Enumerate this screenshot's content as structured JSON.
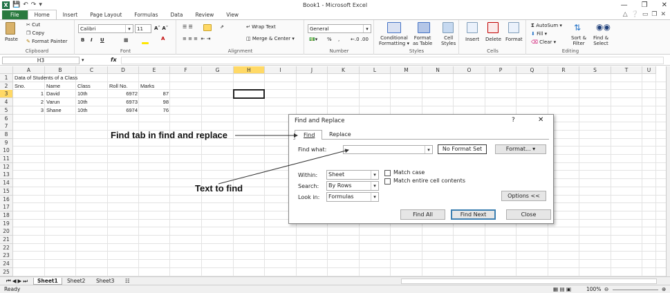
{
  "window": {
    "title": "Book1 - Microsoft Excel"
  },
  "ribbon_tabs": [
    "File",
    "Home",
    "Insert",
    "Page Layout",
    "Formulas",
    "Data",
    "Review",
    "View"
  ],
  "ribbon": {
    "clipboard": {
      "paste": "Paste",
      "cut": "Cut",
      "copy": "Copy",
      "format_painter": "Format Painter",
      "label": "Clipboard"
    },
    "font": {
      "name": "Calibri",
      "size": "11",
      "label": "Font",
      "bold": "B",
      "italic": "I",
      "underline": "U"
    },
    "alignment": {
      "wrap": "Wrap Text",
      "merge": "Merge & Center",
      "label": "Alignment"
    },
    "number": {
      "format": "General",
      "label": "Number",
      "percent": "%",
      "comma": ","
    },
    "styles": {
      "conditional": "Conditional",
      "conditional2": "Formatting",
      "format_table": "Format",
      "format_table2": "as Table",
      "cell_styles": "Cell",
      "cell_styles2": "Styles",
      "label": "Styles"
    },
    "cells": {
      "insert": "Insert",
      "delete": "Delete",
      "format": "Format",
      "label": "Cells"
    },
    "editing": {
      "autosum": "AutoSum",
      "fill": "Fill",
      "clear": "Clear",
      "sort": "Sort &",
      "sort2": "Filter",
      "find": "Find &",
      "find2": "Select",
      "label": "Editing"
    }
  },
  "formula_bar": {
    "name_box": "H3",
    "fx": "fx",
    "formula": ""
  },
  "columns": [
    "A",
    "B",
    "C",
    "D",
    "E",
    "F",
    "G",
    "H",
    "I",
    "J",
    "K",
    "L",
    "M",
    "N",
    "O",
    "P",
    "Q",
    "R",
    "S",
    "T",
    "U"
  ],
  "rows": [
    "1",
    "2",
    "3",
    "4",
    "5",
    "6",
    "7",
    "8",
    "9",
    "10",
    "11",
    "12",
    "13",
    "14",
    "15",
    "16",
    "17",
    "18",
    "19",
    "20",
    "21",
    "22",
    "23",
    "24",
    "25"
  ],
  "cells": {
    "A1": "Data of Students of a Class",
    "A2": "Sno.",
    "B2": "Name",
    "C2": "Class",
    "D2": "Roll No.",
    "E2": "Marks",
    "A3": "1",
    "B3": "David",
    "C3": "10th",
    "D3": "6972",
    "E3": "87",
    "A4": "2",
    "B4": "Varun",
    "C4": "10th",
    "D4": "6973",
    "E4": "98",
    "A5": "3",
    "B5": "Shane",
    "C5": "10th",
    "D5": "6974",
    "E5": "76"
  },
  "sheets": [
    "Sheet1",
    "Sheet2",
    "Sheet3"
  ],
  "status": {
    "ready": "Ready",
    "zoom": "100%"
  },
  "dialog": {
    "title": "Find and Replace",
    "help": "?",
    "close": "✕",
    "tabs": [
      "Find",
      "Replace"
    ],
    "find_what_label": "Find what:",
    "find_what_value": "",
    "no_format": "No Format Set",
    "format_btn": "Format...",
    "within_label": "Within:",
    "within_value": "Sheet",
    "search_label": "Search:",
    "search_value": "By Rows",
    "lookin_label": "Look in:",
    "lookin_value": "Formulas",
    "match_case": "Match case",
    "match_entire": "Match entire cell contents",
    "options_btn": "Options <<",
    "find_all": "Find All",
    "find_next": "Find Next",
    "close_btn": "Close"
  },
  "annotations": {
    "find_tab": "Find tab in find and replace",
    "text_to_find": "Text to find"
  },
  "colors": {
    "excel_green": "#1e7145",
    "selected_header": "#ffd966"
  }
}
